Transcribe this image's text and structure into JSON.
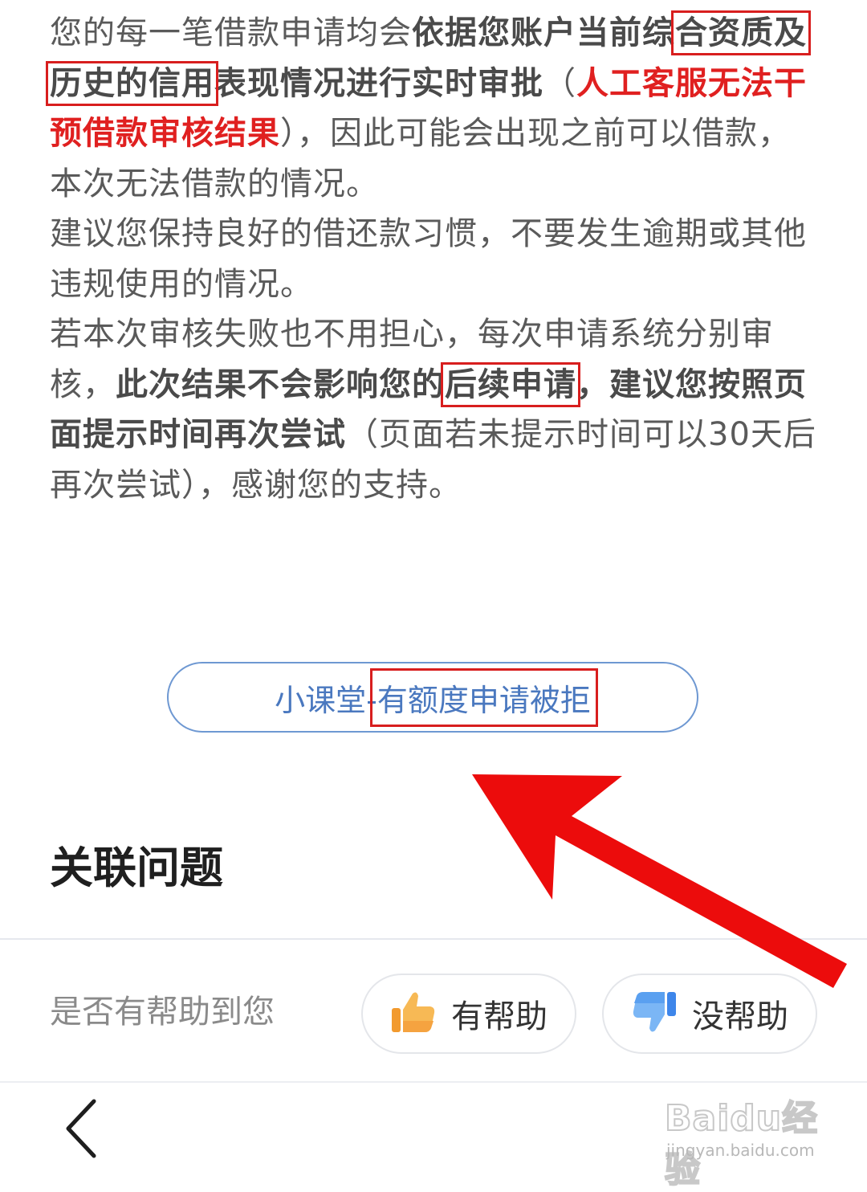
{
  "article": {
    "p1": {
      "s1": "您的每一笔借款申请均会",
      "s2": "依据您账户当前综",
      "s3": "合资质及历史的信用",
      "s4": "表现情况进行实时审批",
      "s5": "（",
      "s6": "人工客服无法干预借款审核结果",
      "s7": "），因此可能会出现之前可以借款，本次无法借款的情况。"
    },
    "p2": "建议您保持良好的借还款习惯，不要发生逾期或其他违规使用的情况。",
    "p3": {
      "s1": "若本次审核失败也不用担心，每次申请系统分别审核，",
      "s2": "此次结果不会影响您的",
      "s3": "后续申请",
      "s4": "，建议您按照页面提示时间再次尝试",
      "s5": "（页面若未提示时间可以30天后再次尝试），感谢您的支持。"
    }
  },
  "link_pill": {
    "prefix": "小课堂-",
    "title": "有额度申请被拒"
  },
  "related": {
    "title": "关联问题"
  },
  "feedback": {
    "question": "是否有帮助到您",
    "yes_label": "有帮助",
    "no_label": "没帮助"
  },
  "watermark": {
    "logo": "Baidu经验",
    "url": "jingyan.baidu.com"
  },
  "icons": {
    "back": "chevron-left-icon",
    "yes": "thumbs-up-icon",
    "no": "thumbs-down-icon"
  },
  "colors": {
    "accent_blue": "#4a78bf",
    "highlight_red": "#e02020",
    "annotation_red": "#d81e1e",
    "thumb_up": "#f5a340",
    "thumb_down": "#5aa0f0"
  }
}
